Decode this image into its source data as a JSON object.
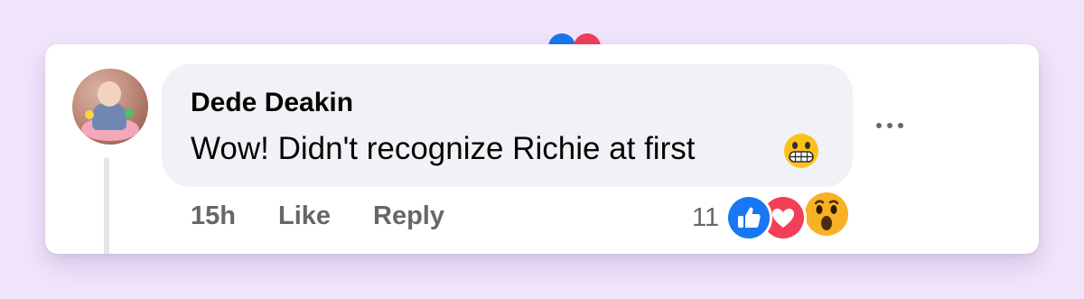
{
  "comment": {
    "author": "Dede Deakin",
    "text": "Wow! Didn't recognize Richie at first",
    "text_emoji": "grimacing-face-emoji",
    "time": "15h",
    "actions": {
      "like": "Like",
      "reply": "Reply"
    },
    "reactions": {
      "count": "11",
      "types": [
        "like",
        "love",
        "wow"
      ]
    }
  },
  "colors": {
    "page_bg": "#f1e5fb",
    "bubble_bg": "#f0f2f5",
    "meta_text": "#65676b",
    "like_blue": "#1877f2",
    "love_red": "#f33e58",
    "wow_yellow": "#f7b125"
  }
}
